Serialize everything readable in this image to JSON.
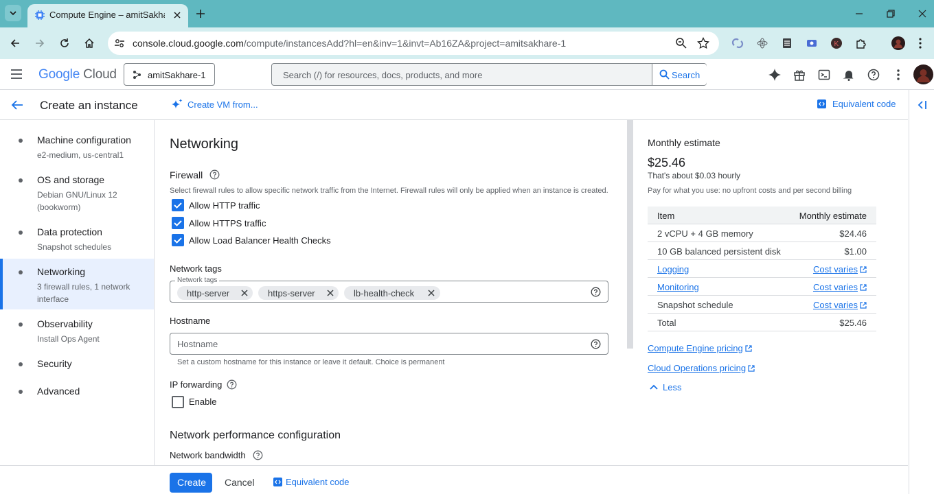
{
  "browser": {
    "tab_title": "Compute Engine – amitSakhare",
    "url_host": "console.cloud.google.com",
    "url_path": "/compute/instancesAdd?hl=en&inv=1&invt=Ab16ZA&project=amitsakhare-1"
  },
  "header": {
    "logo_google": "Google",
    "logo_cloud": " Cloud",
    "project": "amitSakhare-1",
    "search_placeholder": "Search (/) for resources, docs, products, and more",
    "search_button": "Search"
  },
  "page": {
    "title": "Create an instance",
    "create_vm_from": "Create VM from...",
    "equivalent_code": "Equivalent code"
  },
  "nav": [
    {
      "label": "Machine configuration",
      "sub": "e2-medium, us-central1"
    },
    {
      "label": "OS and storage",
      "sub": "Debian GNU/Linux 12 (bookworm)"
    },
    {
      "label": "Data protection",
      "sub": "Snapshot schedules"
    },
    {
      "label": "Networking",
      "sub": "3 firewall rules, 1 network interface"
    },
    {
      "label": "Observability",
      "sub": "Install Ops Agent"
    },
    {
      "label": "Security",
      "sub": ""
    },
    {
      "label": "Advanced",
      "sub": ""
    }
  ],
  "networking": {
    "title": "Networking",
    "firewall_title": "Firewall",
    "firewall_desc": "Select firewall rules to allow specific network traffic from the Internet. Firewall rules will only be applied when an instance is created.",
    "rules": [
      {
        "label": "Allow HTTP traffic",
        "checked": true
      },
      {
        "label": "Allow HTTPS traffic",
        "checked": true
      },
      {
        "label": "Allow Load Balancer Health Checks",
        "checked": true
      }
    ],
    "tags_title": "Network tags",
    "tags_field_label": "Network tags",
    "tags": [
      "http-server",
      "https-server",
      "lb-health-check"
    ],
    "hostname_title": "Hostname",
    "hostname_placeholder": "Hostname",
    "hostname_hint": "Set a custom hostname for this instance or leave it default. Choice is permanent",
    "ipfwd_title": "IP forwarding",
    "ipfwd_enable": "Enable",
    "perf_title": "Network performance configuration",
    "bandwidth_title": "Network bandwidth"
  },
  "estimate": {
    "title": "Monthly estimate",
    "price": "$25.46",
    "hourly": "That's about $0.03 hourly",
    "note": "Pay for what you use: no upfront costs and per second billing",
    "col_item": "Item",
    "col_est": "Monthly estimate",
    "rows": [
      {
        "item": "2 vCPU + 4 GB memory",
        "value": "$24.46"
      },
      {
        "item": "10 GB balanced persistent disk",
        "value": "$1.00"
      },
      {
        "item": "Logging",
        "value": "Cost varies"
      },
      {
        "item": "Monitoring",
        "value": "Cost varies"
      },
      {
        "item": "Snapshot schedule",
        "value": "Cost varies"
      },
      {
        "item": "Total",
        "value": "$25.46"
      }
    ],
    "link_ce_pricing": "Compute Engine pricing",
    "link_ops_pricing": "Cloud Operations pricing",
    "less": "Less"
  },
  "footer": {
    "create": "Create",
    "cancel": "Cancel",
    "equivalent_code": "Equivalent code"
  }
}
